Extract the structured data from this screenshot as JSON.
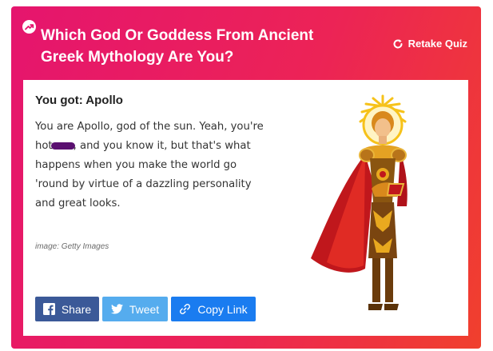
{
  "quiz": {
    "title": "Which God Or Goddess From Ancient Greek Mythology Are You?",
    "retake_label": "Retake Quiz"
  },
  "result": {
    "heading": "You got: Apollo",
    "description_part1": "You are Apollo, god of the sun. Yeah, you're hot",
    "description_part2": ", and you know it, but that's what happens when you make the world go 'round by virtue of a dazzling personality and great looks.",
    "image_credit": "image: Getty Images",
    "illustration": "apollo-sun-god-illustration"
  },
  "share": {
    "facebook_label": "Share",
    "twitter_label": "Tweet",
    "copy_link_label": "Copy Link"
  },
  "colors": {
    "gradient_start": "#e5156e",
    "gradient_end": "#f0402d",
    "facebook": "#3b5998",
    "twitter": "#55acee",
    "copy_link": "#1a7cf0",
    "redaction": "#5a1070"
  },
  "icons": {
    "trending": "trending-arrow-icon",
    "retake": "refresh-icon",
    "facebook": "facebook-icon",
    "twitter": "twitter-bird-icon",
    "link": "link-icon"
  }
}
